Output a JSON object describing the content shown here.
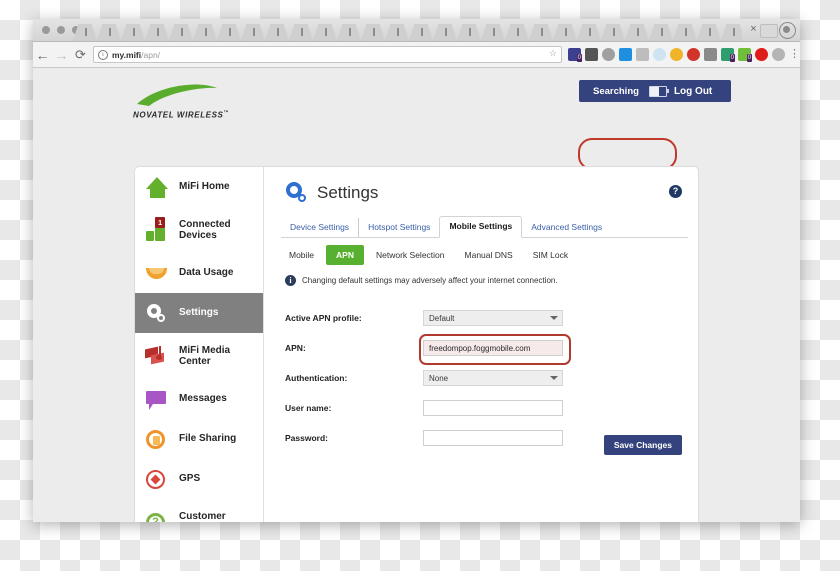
{
  "browser": {
    "url_host": "my.mifi",
    "url_path": "/apn/",
    "url_full": "my.mifi/apn/",
    "back_icon": "back-arrow-icon",
    "forward_icon": "forward-arrow-icon",
    "reload_icon": "reload-icon",
    "info_icon": "info-circle-icon",
    "bookmark_icon": "star-icon",
    "menu_icon": "kebab-menu-icon",
    "tab_close": "×",
    "extensions": [
      {
        "name": "extension-1",
        "color": "#3d3f8f",
        "badge": "0"
      },
      {
        "name": "extension-2",
        "color": "#555555"
      },
      {
        "name": "extension-3",
        "color": "#a0a0a0"
      },
      {
        "name": "extension-4",
        "color": "#1f8fe0"
      },
      {
        "name": "extension-5",
        "color": "#bdbdbd"
      },
      {
        "name": "extension-6",
        "color": "#cfe3f0"
      },
      {
        "name": "extension-7",
        "color": "#f0b429"
      },
      {
        "name": "extension-8",
        "color": "#d1342b"
      },
      {
        "name": "extension-9",
        "color": "#8a8a8a"
      },
      {
        "name": "extension-10",
        "color": "#2f9e6e",
        "badge": "0"
      },
      {
        "name": "extension-11",
        "color": "#6fbf3a",
        "badge": "0"
      },
      {
        "name": "extension-12",
        "color": "#e01b1b"
      },
      {
        "name": "extension-13",
        "color": "#b5b5b5"
      }
    ]
  },
  "brand": {
    "name": "NOVATEL WIRELESS",
    "tm": "™",
    "swoosh_color": "#5aac2e"
  },
  "status": {
    "connection_label": "Searching",
    "logout_label": "Log Out",
    "battery_icon": "battery-icon",
    "bar_color": "#34427e"
  },
  "annotations": {
    "status_highlight_color": "#c0392b",
    "apn_highlight_color": "#b03a2e"
  },
  "sidebar": {
    "items": [
      {
        "label": "MiFi Home",
        "icon": "home-icon",
        "active": false
      },
      {
        "label": "Connected Devices",
        "icon": "devices-icon",
        "active": false,
        "badge": "1"
      },
      {
        "label": "Data Usage",
        "icon": "data-usage-icon",
        "active": false
      },
      {
        "label": "Settings",
        "icon": "gear-icon",
        "active": true
      },
      {
        "label": "MiFi Media Center",
        "icon": "media-icon",
        "active": false
      },
      {
        "label": "Messages",
        "icon": "message-icon",
        "active": false
      },
      {
        "label": "File Sharing",
        "icon": "file-sharing-icon",
        "active": false
      },
      {
        "label": "GPS",
        "icon": "gps-icon",
        "active": false
      },
      {
        "label": "Customer Support",
        "icon": "support-icon",
        "active": false
      }
    ]
  },
  "main": {
    "title": "Settings",
    "title_icon": "gear-icon",
    "help_icon": "help-icon",
    "help_glyph": "?",
    "tabs": [
      {
        "label": "Device Settings",
        "active": false
      },
      {
        "label": "Hotspot Settings",
        "active": false
      },
      {
        "label": "Mobile Settings",
        "active": true
      },
      {
        "label": "Advanced Settings",
        "active": false
      }
    ],
    "subtabs": [
      {
        "label": "Mobile",
        "active": false
      },
      {
        "label": "APN",
        "active": true
      },
      {
        "label": "Network Selection",
        "active": false
      },
      {
        "label": "Manual DNS",
        "active": false
      },
      {
        "label": "SIM Lock",
        "active": false
      }
    ],
    "notice": {
      "icon": "info-icon",
      "glyph": "i",
      "text": "Changing default settings may adversely affect your internet connection."
    },
    "form": {
      "fields": [
        {
          "label": "Active APN profile:",
          "type": "select",
          "value": "Default",
          "highlighted": false
        },
        {
          "label": "APN:",
          "type": "text",
          "value": "freedompop.foggmobile.com",
          "highlighted": true
        },
        {
          "label": "Authentication:",
          "type": "select",
          "value": "None",
          "highlighted": false
        },
        {
          "label": "User name:",
          "type": "text",
          "value": "",
          "highlighted": false
        },
        {
          "label": "Password:",
          "type": "text",
          "value": "",
          "highlighted": false
        }
      ],
      "save_label": "Save Changes"
    }
  }
}
